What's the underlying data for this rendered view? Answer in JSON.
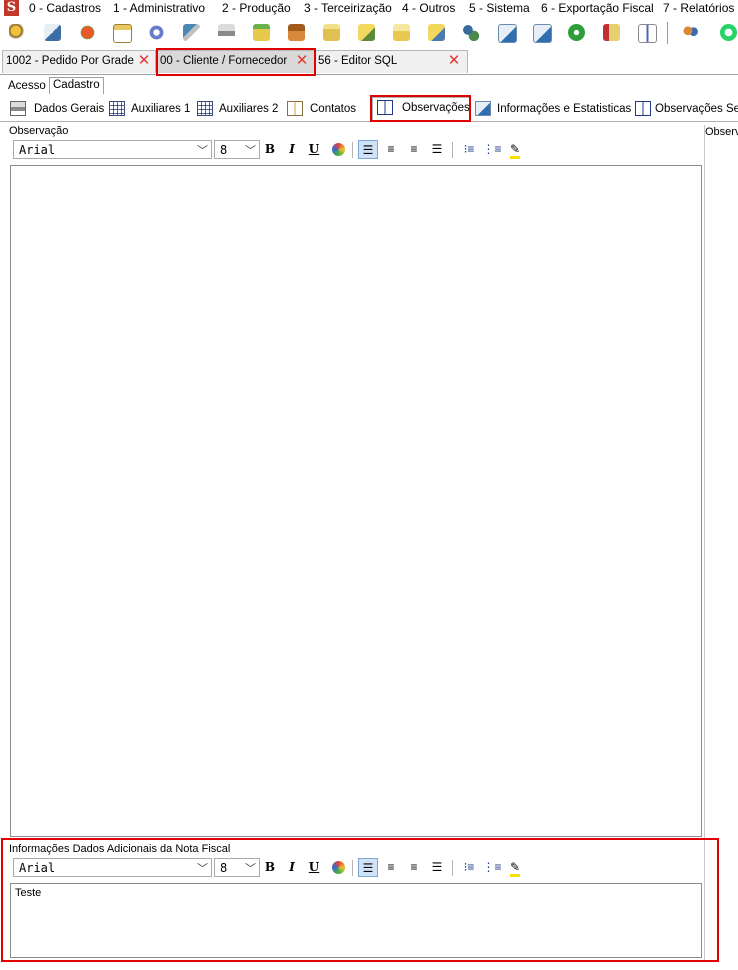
{
  "menu": {
    "logo": "S",
    "items": [
      "0 - Cadastros",
      "1 - Administrativo",
      "2 - Produção",
      "3 - Terceirização",
      "4 - Outros",
      "5 - Sistema",
      "6 - Exportação Fiscal",
      "7 - Relatórios E"
    ]
  },
  "toolbar": {
    "icons": [
      "search-icon",
      "edit-icon",
      "fruit-icon",
      "calendar-icon",
      "gear-icon",
      "tools-icon",
      "printer-icon",
      "flask-icon",
      "box-icon",
      "folder-icon",
      "folder-edit-icon",
      "folder-open-icon",
      "folder-note-icon",
      "users-icon",
      "document-edit-icon",
      "document-check-icon",
      "check-circle-icon",
      "report-icon",
      "book-icon",
      "people-icon",
      "whatsapp-icon"
    ]
  },
  "doc_tabs": [
    {
      "label": "1002 - Pedido Por Grade",
      "active": false
    },
    {
      "label": "00 - Cliente / Fornecedor",
      "active": true
    },
    {
      "label": "56 - Editor SQL",
      "active": false
    }
  ],
  "section_tabs": {
    "acesso": "Acesso",
    "cadastro": "Cadastro"
  },
  "sub_tabs": [
    {
      "label": "Dados Gerais",
      "icon": "printer-icon"
    },
    {
      "label": "Auxiliares 1",
      "icon": "grid-icon"
    },
    {
      "label": "Auxiliares 2",
      "icon": "grid-icon"
    },
    {
      "label": "Contatos",
      "icon": "book-open-icon"
    },
    {
      "label": "Observações",
      "icon": "book-icon",
      "active": true
    },
    {
      "label": "Informações e Estatisticas",
      "icon": "document-edit-icon"
    },
    {
      "label": "Observações Ser",
      "icon": "book-icon"
    }
  ],
  "observacao": {
    "label": "Observação",
    "font": "Arial",
    "size": "8",
    "text": ""
  },
  "right_column_label": "Observ",
  "nota_fiscal": {
    "label": "Informações Dados Adicionais da Nota Fiscal",
    "font": "Arial",
    "size": "8",
    "text": "Teste"
  },
  "format_buttons": {
    "bold": "B",
    "italic": "I",
    "underline": "U"
  },
  "colors": {
    "highlight_red": "#e00000",
    "close_red": "#e53935",
    "logo_red": "#c0392b",
    "pressed_blue": "#cfe2f7"
  }
}
